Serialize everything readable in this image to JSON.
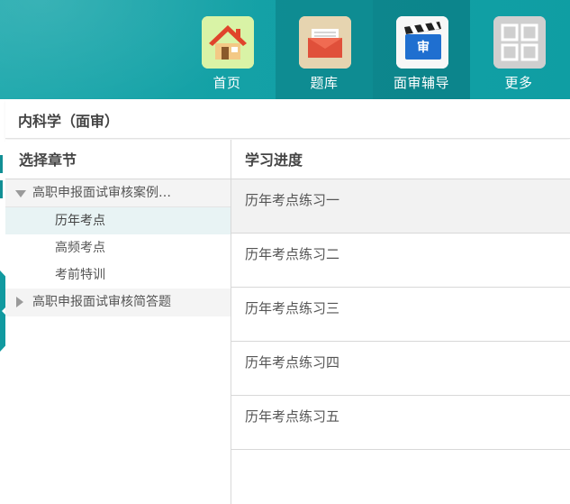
{
  "nav": {
    "items": [
      {
        "label": "首页",
        "icon": "home-icon"
      },
      {
        "label": "题库",
        "icon": "mail-box-icon"
      },
      {
        "label": "面审辅导",
        "icon": "clapperboard-icon",
        "badge": "审"
      },
      {
        "label": "更多",
        "icon": "grid-icon"
      }
    ]
  },
  "page": {
    "title": "内科学（面审）"
  },
  "chapters": {
    "header": "选择章节",
    "groups": [
      {
        "label": "高职申报面试审核案例…",
        "expanded": true,
        "children": [
          "历年考点",
          "高频考点",
          "考前特训"
        ],
        "selected_child": "历年考点"
      },
      {
        "label": "高职申报面试审核简答题",
        "expanded": false
      }
    ]
  },
  "progress": {
    "header": "学习进度",
    "items": [
      "历年考点练习一",
      "历年考点练习二",
      "历年考点练习三",
      "历年考点练习四",
      "历年考点练习五"
    ]
  },
  "colors": {
    "accent": "#14a1a6",
    "active_nav": "#0e8c91"
  }
}
